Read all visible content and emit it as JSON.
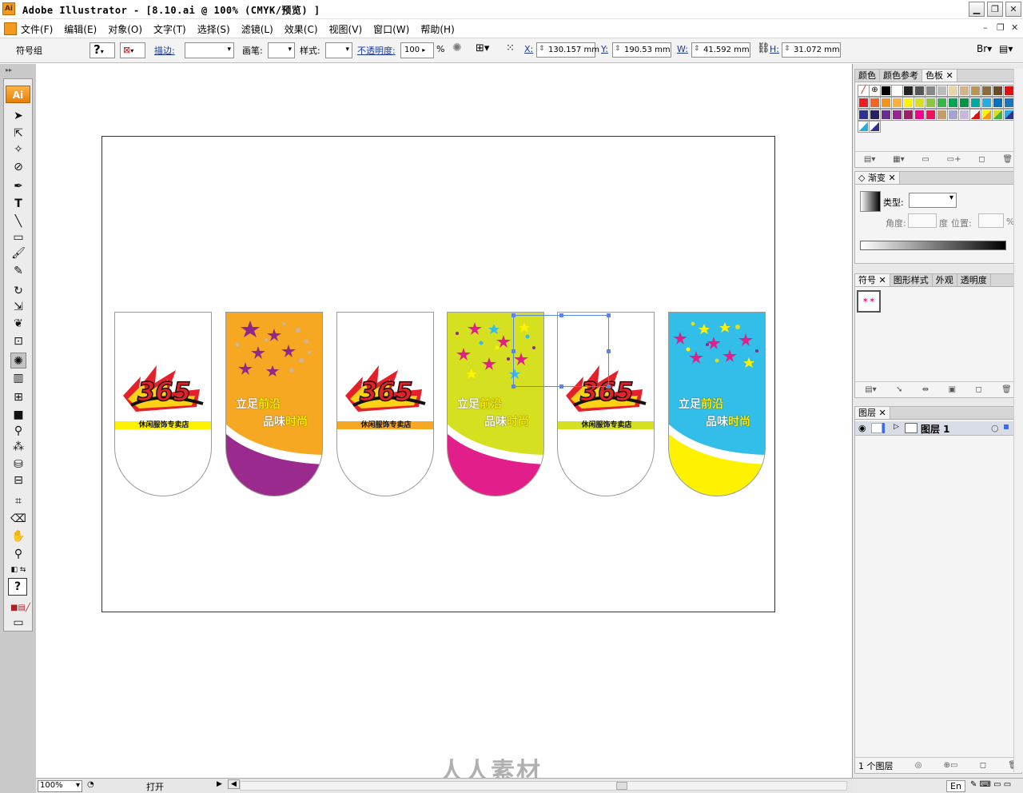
{
  "window": {
    "title": "Adobe Illustrator - [8.10.ai @ 100% (CMYK/预览) ]",
    "logo": "Ai"
  },
  "menu": [
    "文件(F)",
    "编辑(E)",
    "对象(O)",
    "文字(T)",
    "选择(S)",
    "滤镜(L)",
    "效果(C)",
    "视图(V)",
    "窗口(W)",
    "帮助(H)"
  ],
  "control": {
    "selection_type": "符号组",
    "stroke_label": "描边:",
    "brush_label": "画笔:",
    "style_label": "样式:",
    "opacity_label": "不透明度:",
    "opacity_value": "100",
    "opacity_unit": "%",
    "x_label": "X:",
    "x_value": "130.157 mm",
    "y_label": "Y:",
    "y_value": "190.53 mm",
    "w_label": "W:",
    "w_value": "41.592 mm",
    "h_label": "H:",
    "h_value": "31.072 mm"
  },
  "toolbox": {
    "logo": "Ai"
  },
  "artwork": {
    "logo_text": "365",
    "store_name": "休闲服饰专卖店",
    "slogan_line1_a": "立足",
    "slogan_line1_b": "前沿",
    "slogan_line2_a": "品味",
    "slogan_line2_b": "时尚",
    "colors": {
      "orange": "#f7a823",
      "lime": "#d5e021",
      "cyan": "#33bde9",
      "purple": "#9b2a8e",
      "magenta": "#e21e8a",
      "yellow": "#fff200"
    }
  },
  "panels": {
    "swatches": {
      "tabs": [
        "颜色",
        "颜色参考",
        "色板"
      ]
    },
    "gradient": {
      "tab": "渐变",
      "type_label": "类型:",
      "angle_label": "角度:",
      "angle_unit": "度",
      "position_label": "位置:",
      "position_unit": "%"
    },
    "symbols": {
      "tabs": [
        "符号",
        "图形样式",
        "外观",
        "透明度"
      ]
    },
    "layers": {
      "tab": "图层",
      "layer_name": "图层 1",
      "footer_count": "1 个图层"
    }
  },
  "status": {
    "zoom": "100%",
    "status_text": "打开"
  },
  "taskbar": {
    "lang": "En"
  },
  "watermark": "人人素材"
}
